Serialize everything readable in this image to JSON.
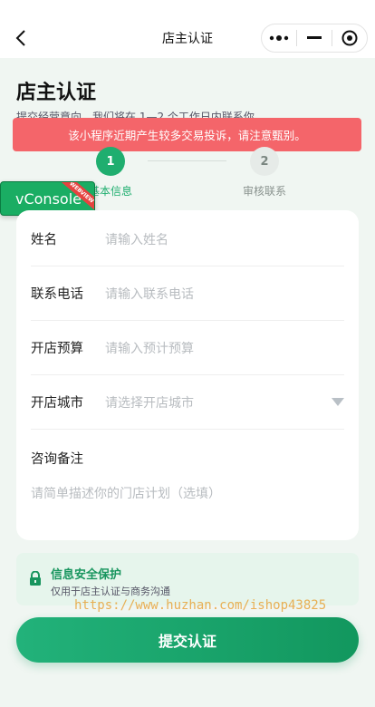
{
  "nav": {
    "title": "店主认证"
  },
  "page": {
    "title": "店主认证",
    "subtitle": "提交经营意向，我们将在 1—2 个工作日内联系你"
  },
  "alert": {
    "text": "该小程序近期产生较多交易投诉，请注意甄别。"
  },
  "steps": [
    {
      "num": "1",
      "label": "基本信息",
      "active": true
    },
    {
      "num": "2",
      "label": "审核联系",
      "active": false
    }
  ],
  "vconsole": {
    "label": "vConsole",
    "ribbon": "WEBVIEW"
  },
  "form": {
    "name": {
      "label": "姓名",
      "placeholder": "请输入姓名"
    },
    "phone": {
      "label": "联系电话",
      "placeholder": "请输入联系电话"
    },
    "budget": {
      "label": "开店预算",
      "placeholder": "请输入预计预算"
    },
    "city": {
      "label": "开店城市",
      "placeholder": "请选择开店城市"
    },
    "note": {
      "label": "咨询备注",
      "placeholder": "请简单描述你的门店计划（选填）"
    }
  },
  "security": {
    "title": "信息安全保护",
    "desc": "仅用于店主认证与商务沟通"
  },
  "watermark": "https://www.huzhan.com/ishop43825",
  "submit": {
    "label": "提交认证"
  },
  "colors": {
    "accent": "#1fae6f",
    "alert": "#f4656a",
    "vconsole": "#1aad63"
  }
}
